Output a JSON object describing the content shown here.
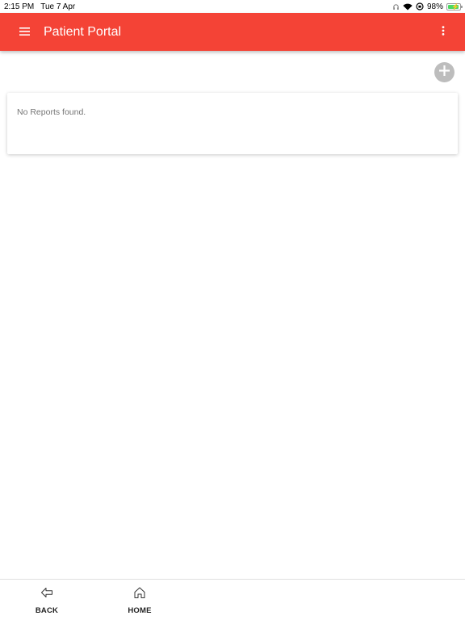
{
  "status_bar": {
    "time": "2:15 PM",
    "date": "Tue 7 Apr",
    "battery": "98%",
    "icons": [
      "headphones-icon",
      "wifi-icon",
      "orientation-lock-icon",
      "battery-icon"
    ]
  },
  "app_bar": {
    "title": "Patient Portal",
    "background_color": "#f44336",
    "menu_icon": "hamburger-menu-icon",
    "overflow_icon": "more-vert-icon"
  },
  "add_button": {
    "icon": "plus-icon",
    "color": "#bdbdbd"
  },
  "reports": {
    "empty_message": "No Reports found."
  },
  "bottom_nav": {
    "items": [
      {
        "label": "BACK",
        "icon": "back-arrow-icon"
      },
      {
        "label": "HOME",
        "icon": "home-icon"
      }
    ]
  }
}
